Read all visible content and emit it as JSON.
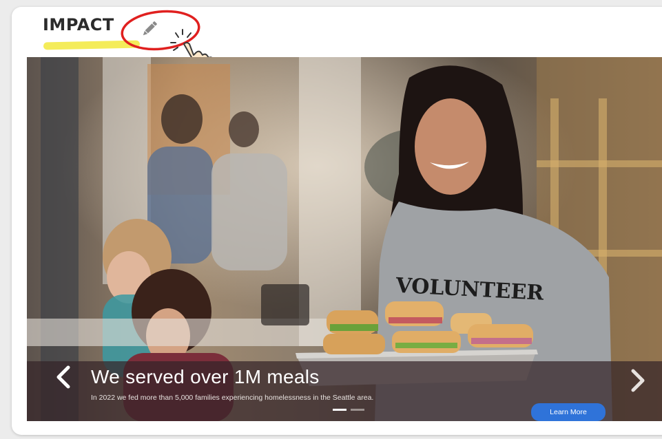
{
  "header": {
    "title": "IMPACT"
  },
  "slide": {
    "title": "We served over 1M meals",
    "text": "In 2022 we fed more than 5,000 families experiencing homelessness in the Seattle area.",
    "button_label": "Learn More",
    "total_slides": 2,
    "active_slide": 1
  },
  "icons": {
    "edit": "pencil-icon",
    "cursor": "hand-pointer-icon",
    "prev": "chevron-left-icon",
    "next": "chevron-right-icon"
  },
  "colors": {
    "highlight": "#f4ec5a",
    "annotation": "#e0201f",
    "button": "#2f73d9",
    "caption_overlay": "#342428"
  },
  "photo_text": {
    "shirt": "VOLUNTEER"
  }
}
